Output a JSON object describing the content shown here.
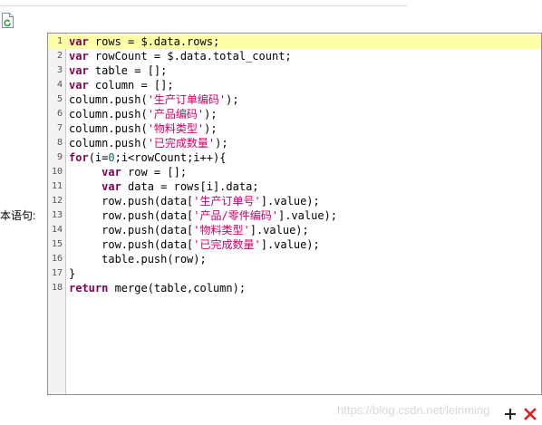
{
  "form": {
    "script_label": "本语句:"
  },
  "icons": {
    "refresh": "refresh-document-icon",
    "add": "plus-icon",
    "delete": "close-icon"
  },
  "colors": {
    "keyword": "#7f0055",
    "string": "#cc0066",
    "number": "#116644",
    "active_line": "#ffffa8",
    "delete": "#e02020"
  },
  "editor": {
    "active_line": 1,
    "lines": [
      [
        [
          "kw",
          "var"
        ],
        [
          "p",
          " rows = $.data.rows;"
        ]
      ],
      [
        [
          "kw",
          "var"
        ],
        [
          "p",
          " rowCount = $.data.total_count;"
        ]
      ],
      [
        [
          "kw",
          "var"
        ],
        [
          "p",
          " table = [];"
        ]
      ],
      [
        [
          "kw",
          "var"
        ],
        [
          "p",
          " column = [];"
        ]
      ],
      [
        [
          "p",
          "column.push("
        ],
        [
          "str",
          "'生产订单编码'"
        ],
        [
          "p",
          ");"
        ]
      ],
      [
        [
          "p",
          "column.push("
        ],
        [
          "str",
          "'产品编码'"
        ],
        [
          "p",
          ");"
        ]
      ],
      [
        [
          "p",
          "column.push("
        ],
        [
          "str",
          "'物料类型'"
        ],
        [
          "p",
          ");"
        ]
      ],
      [
        [
          "p",
          "column.push("
        ],
        [
          "str",
          "'已完成数量'"
        ],
        [
          "p",
          ");"
        ]
      ],
      [
        [
          "kw",
          "for"
        ],
        [
          "p",
          "(i="
        ],
        [
          "num",
          "0"
        ],
        [
          "p",
          ";i<rowCount;i++){"
        ]
      ],
      [
        [
          "p",
          "     "
        ],
        [
          "kw",
          "var"
        ],
        [
          "p",
          " row = [];"
        ]
      ],
      [
        [
          "p",
          "     "
        ],
        [
          "kw",
          "var"
        ],
        [
          "p",
          " data = rows[i].data;"
        ]
      ],
      [
        [
          "p",
          "     row.push(data["
        ],
        [
          "str",
          "'生产订单号'"
        ],
        [
          "p",
          "].value);"
        ]
      ],
      [
        [
          "p",
          "     row.push(data["
        ],
        [
          "str",
          "'产品/零件编码'"
        ],
        [
          "p",
          "].value);"
        ]
      ],
      [
        [
          "p",
          "     row.push(data["
        ],
        [
          "str",
          "'物料类型'"
        ],
        [
          "p",
          "].value);"
        ]
      ],
      [
        [
          "p",
          "     row.push(data["
        ],
        [
          "str",
          "'已完成数量'"
        ],
        [
          "p",
          "].value);"
        ]
      ],
      [
        [
          "p",
          "     table.push(row);"
        ]
      ],
      [
        [
          "p",
          "}"
        ]
      ],
      [
        [
          "kw",
          "return"
        ],
        [
          "p",
          " merge(table,column);"
        ]
      ]
    ]
  },
  "watermark": "https://blog.csdn.net/leinming"
}
